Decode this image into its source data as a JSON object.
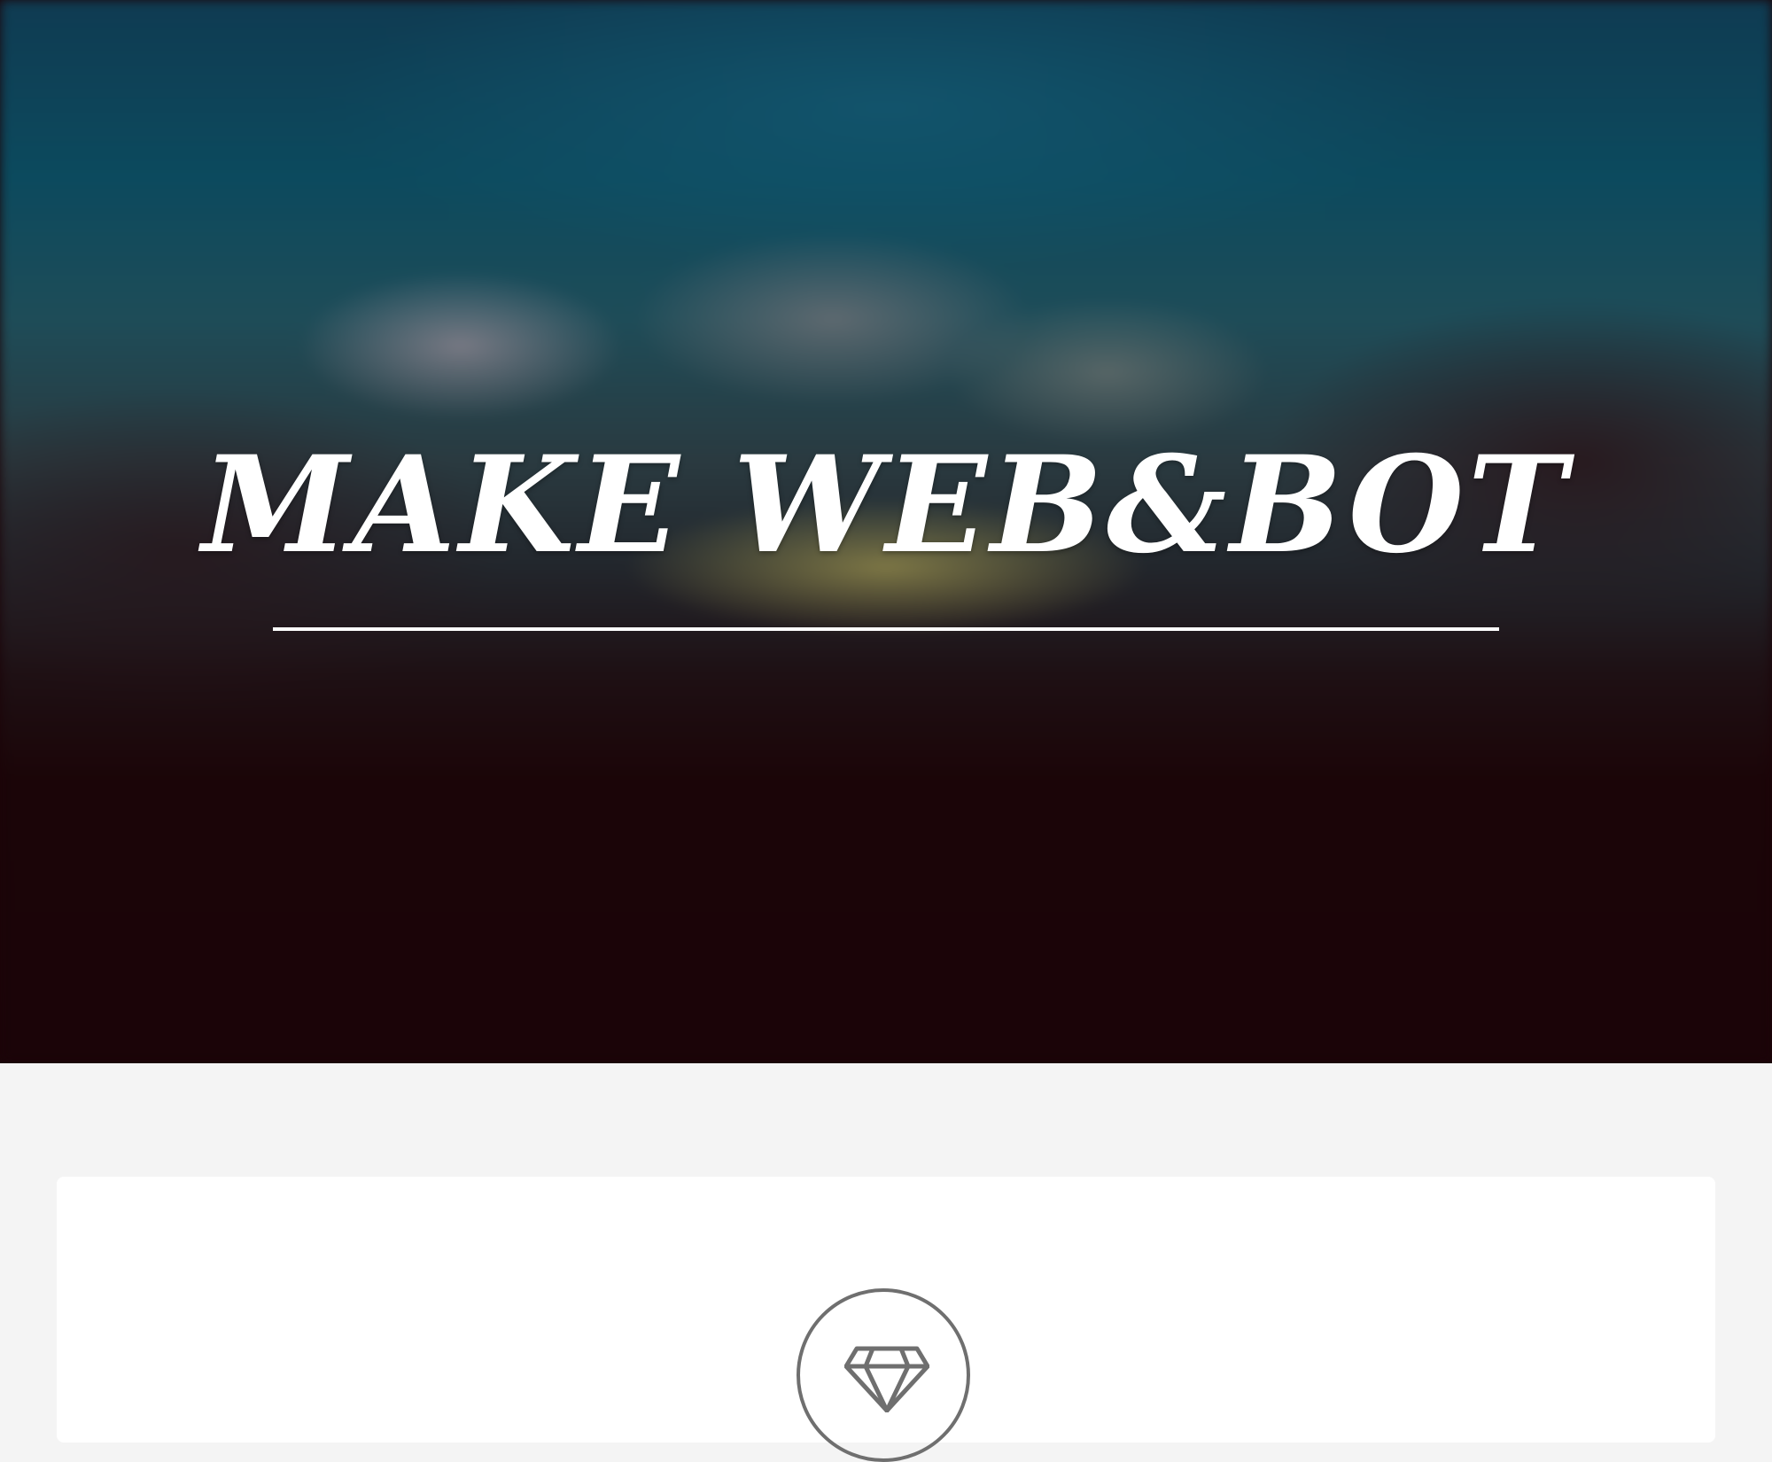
{
  "hero": {
    "title": "MAKE WEB&BOT"
  },
  "features": {
    "icon": "diamond-icon"
  }
}
